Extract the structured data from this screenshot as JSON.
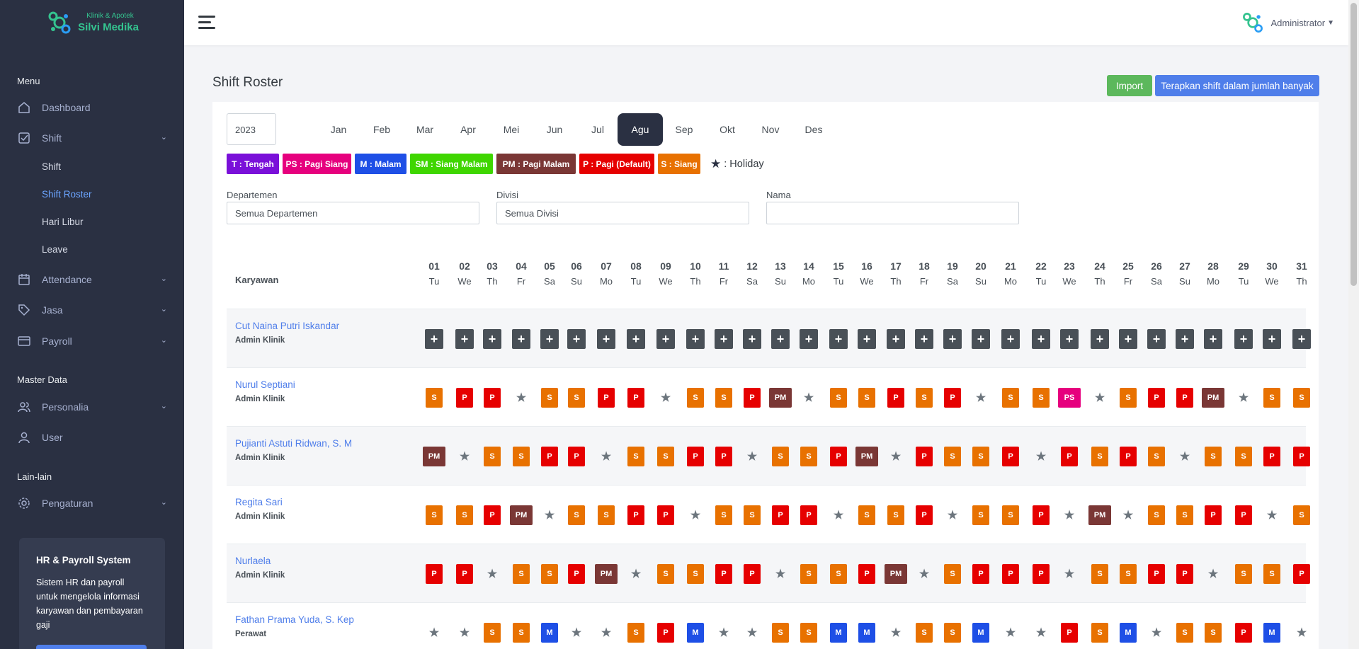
{
  "brand": {
    "subtitle": "Klinik & Apotek",
    "name": "Silvi Medika"
  },
  "colors": {
    "sidebar": "#2a3042",
    "accent": "#4f7eea",
    "success": "#5cb85c",
    "T": "#7a10d9",
    "PS": "#e6007e",
    "M": "#1e4fe6",
    "SM": "#3fd600",
    "PM": "#7a3735",
    "P": "#e60000",
    "S": "#e87100"
  },
  "sidebar": {
    "section_menu": "Menu",
    "section_master": "Master Data",
    "section_other": "Lain-lain",
    "items": {
      "dashboard": "Dashboard",
      "shift": "Shift",
      "shift_sub": "Shift",
      "shift_roster": "Shift Roster",
      "hari_libur": "Hari Libur",
      "leave": "Leave",
      "attendance": "Attendance",
      "jasa": "Jasa",
      "payroll": "Payroll",
      "personalia": "Personalia",
      "user": "User",
      "pengaturan": "Pengaturan"
    },
    "promo": {
      "title": "HR & Payroll System",
      "text": "Sistem HR dan payroll untuk mengelola informasi karyawan dan pembayaran gaji"
    }
  },
  "header": {
    "user": "Administrator"
  },
  "page": {
    "title": "Shift Roster",
    "import_label": "Import",
    "bulk_label": "Terapkan shift dalam jumlah banyak"
  },
  "year": "2023",
  "months": [
    "Jan",
    "Feb",
    "Mar",
    "Apr",
    "Mei",
    "Jun",
    "Jul",
    "Agu",
    "Sep",
    "Okt",
    "Nov",
    "Des"
  ],
  "active_month": "Agu",
  "legend": [
    {
      "code": "T",
      "label": "T : Tengah"
    },
    {
      "code": "PS",
      "label": "PS : Pagi Siang"
    },
    {
      "code": "M",
      "label": "M : Malam"
    },
    {
      "code": "SM",
      "label": "SM : Siang Malam"
    },
    {
      "code": "PM",
      "label": "PM : Pagi Malam"
    },
    {
      "code": "P",
      "label": "P : Pagi (Default)"
    },
    {
      "code": "S",
      "label": "S : Siang"
    }
  ],
  "holiday_label": ": Holiday",
  "filters": {
    "departemen_label": "Departemen",
    "departemen_value": "Semua Departemen",
    "divisi_label": "Divisi",
    "divisi_value": "Semua Divisi",
    "nama_label": "Nama",
    "nama_value": ""
  },
  "table": {
    "employee_header": "Karyawan",
    "days": [
      {
        "d": "01",
        "w": "Tu"
      },
      {
        "d": "02",
        "w": "We"
      },
      {
        "d": "03",
        "w": "Th"
      },
      {
        "d": "04",
        "w": "Fr"
      },
      {
        "d": "05",
        "w": "Sa"
      },
      {
        "d": "06",
        "w": "Su"
      },
      {
        "d": "07",
        "w": "Mo"
      },
      {
        "d": "08",
        "w": "Tu"
      },
      {
        "d": "09",
        "w": "We"
      },
      {
        "d": "10",
        "w": "Th"
      },
      {
        "d": "11",
        "w": "Fr"
      },
      {
        "d": "12",
        "w": "Sa"
      },
      {
        "d": "13",
        "w": "Su"
      },
      {
        "d": "14",
        "w": "Mo"
      },
      {
        "d": "15",
        "w": "Tu"
      },
      {
        "d": "16",
        "w": "We"
      },
      {
        "d": "17",
        "w": "Th"
      },
      {
        "d": "18",
        "w": "Fr"
      },
      {
        "d": "19",
        "w": "Sa"
      },
      {
        "d": "20",
        "w": "Su"
      },
      {
        "d": "21",
        "w": "Mo"
      },
      {
        "d": "22",
        "w": "Tu"
      },
      {
        "d": "23",
        "w": "We"
      },
      {
        "d": "24",
        "w": "Th"
      },
      {
        "d": "25",
        "w": "Fr"
      },
      {
        "d": "26",
        "w": "Sa"
      },
      {
        "d": "27",
        "w": "Su"
      },
      {
        "d": "28",
        "w": "Mo"
      },
      {
        "d": "29",
        "w": "Tu"
      },
      {
        "d": "30",
        "w": "We"
      },
      {
        "d": "31",
        "w": "Th"
      }
    ],
    "employees": [
      {
        "name": "Cut Naina Putri Iskandar",
        "role": "Admin Klinik",
        "shifts": [
          "+",
          "+",
          "+",
          "+",
          "+",
          "+",
          "+",
          "+",
          "+",
          "+",
          "+",
          "+",
          "+",
          "+",
          "+",
          "+",
          "+",
          "+",
          "+",
          "+",
          "+",
          "+",
          "+",
          "+",
          "+",
          "+",
          "+",
          "+",
          "+",
          "+",
          "+"
        ]
      },
      {
        "name": "Nurul Septiani",
        "role": "Admin Klinik",
        "shifts": [
          "S",
          "P",
          "P",
          "*",
          "S",
          "S",
          "P",
          "P",
          "*",
          "S",
          "S",
          "P",
          "PM",
          "*",
          "S",
          "S",
          "P",
          "S",
          "P",
          "*",
          "S",
          "S",
          "PS",
          "*",
          "S",
          "P",
          "P",
          "PM",
          "*",
          "S",
          "S"
        ]
      },
      {
        "name": "Pujianti Astuti Ridwan, S. M",
        "role": "Admin Klinik",
        "shifts": [
          "PM",
          "*",
          "S",
          "S",
          "P",
          "P",
          "*",
          "S",
          "S",
          "P",
          "P",
          "*",
          "S",
          "S",
          "P",
          "PM",
          "*",
          "P",
          "S",
          "S",
          "P",
          "*",
          "P",
          "S",
          "P",
          "S",
          "*",
          "S",
          "S",
          "P",
          "P"
        ]
      },
      {
        "name": "Regita Sari",
        "role": "Admin Klinik",
        "shifts": [
          "S",
          "S",
          "P",
          "PM",
          "*",
          "S",
          "S",
          "P",
          "P",
          "*",
          "S",
          "S",
          "P",
          "P",
          "*",
          "S",
          "S",
          "P",
          "*",
          "S",
          "S",
          "P",
          "*",
          "PM",
          "*",
          "S",
          "S",
          "P",
          "P",
          "*",
          "S"
        ]
      },
      {
        "name": "Nurlaela",
        "role": "Admin Klinik",
        "shifts": [
          "P",
          "P",
          "*",
          "S",
          "S",
          "P",
          "PM",
          "*",
          "S",
          "S",
          "P",
          "P",
          "*",
          "S",
          "S",
          "P",
          "PM",
          "*",
          "S",
          "P",
          "P",
          "P",
          "*",
          "S",
          "S",
          "P",
          "P",
          "*",
          "S",
          "S",
          "P"
        ]
      },
      {
        "name": "Fathan Prama Yuda, S. Kep",
        "role": "Perawat",
        "shifts": [
          "*",
          "*",
          "S",
          "S",
          "M",
          "*",
          "*",
          "S",
          "P",
          "M",
          "*",
          "*",
          "S",
          "S",
          "M",
          "M",
          "*",
          "S",
          "S",
          "M",
          "*",
          "*",
          "P",
          "S",
          "M",
          "*",
          "S",
          "S",
          "P",
          "M",
          "*"
        ]
      }
    ]
  }
}
